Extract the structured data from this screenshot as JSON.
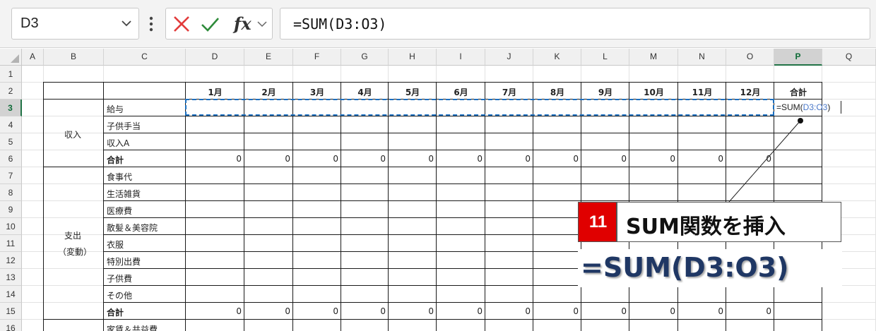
{
  "formula_bar": {
    "name_box": "D3",
    "name_box_dropdown_icon": "chevron-down-icon",
    "more_icon": "vertical-ellipsis-icon",
    "cancel_icon": "x-icon",
    "enter_icon": "checkmark-icon",
    "fx_label": "fx",
    "formula": "=SUM(D3:O3)"
  },
  "colors": {
    "cancel": "#e23b3b",
    "enter": "#2e8b3a",
    "selection": "#217346",
    "marquee": "#1c6fbf",
    "badge": "#e00000",
    "formula_big": "#1f3764"
  },
  "sheet": {
    "columns": [
      "A",
      "B",
      "C",
      "D",
      "E",
      "F",
      "G",
      "H",
      "I",
      "J",
      "K",
      "L",
      "M",
      "N",
      "O",
      "P",
      "Q"
    ],
    "rows": [
      "1",
      "2",
      "3",
      "4",
      "5",
      "6",
      "7",
      "8",
      "9",
      "10",
      "11",
      "12",
      "13",
      "14",
      "15",
      "16"
    ],
    "selected_column": "P",
    "selected_row": "3",
    "months": [
      "1月",
      "2月",
      "3月",
      "4月",
      "5月",
      "6月",
      "7月",
      "8月",
      "9月",
      "10月",
      "11月",
      "12月"
    ],
    "total_header": "合計",
    "groups": {
      "income": "収入",
      "expense_line1": "支出",
      "expense_line2": "（変動）"
    },
    "row_labels": {
      "r3": "給与",
      "r4": "子供手当",
      "r5": "収入A",
      "r6": "合計",
      "r7": "食事代",
      "r8": "生活雑貨",
      "r9": "医療費",
      "r10": "散髪＆美容院",
      "r11": "衣服",
      "r12": "特別出費",
      "r13": "子供費",
      "r14": "その他",
      "r15": "合計",
      "r16": "家賃＆共益費"
    },
    "row6_values": [
      "0",
      "0",
      "0",
      "0",
      "0",
      "0",
      "0",
      "0",
      "0",
      "0",
      "0",
      "0"
    ],
    "row15_values": [
      "0",
      "0",
      "0",
      "0",
      "0",
      "0",
      "0",
      "0",
      "0",
      "0",
      "0",
      "0"
    ],
    "editing_cell": {
      "prefix": "=SUM(",
      "ref": "D3:O3",
      "suffix": ")"
    }
  },
  "callout": {
    "step": "11",
    "label": "SUM関数を挿入",
    "formula": "=SUM(D3:O3)"
  }
}
